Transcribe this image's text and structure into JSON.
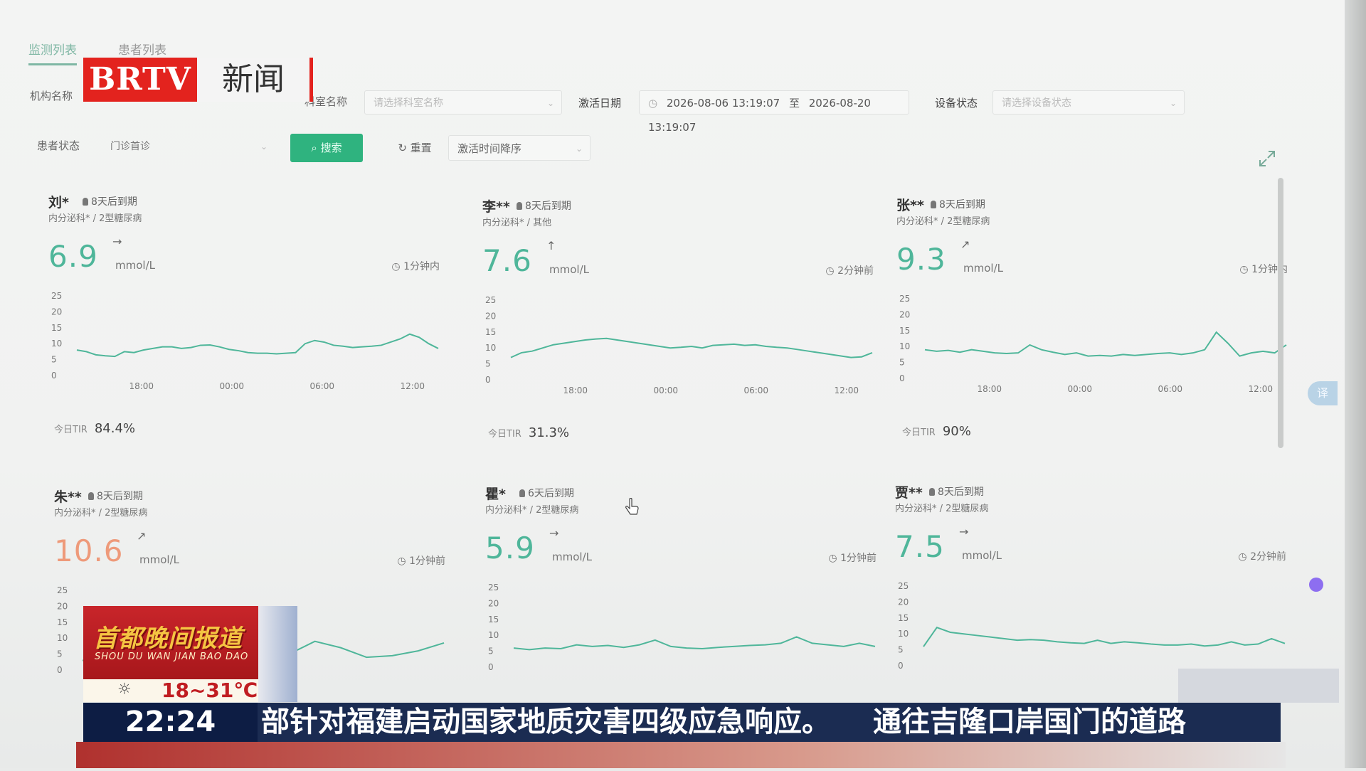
{
  "tabs": [
    "监测列表",
    "患者列表"
  ],
  "filters": {
    "org_label": "机构名称",
    "dept_label": "科室名称",
    "dept_placeholder": "请选择科室名称",
    "activation_label": "激活日期",
    "date_start": "2026-08-06 13:19:07",
    "date_sep": "至",
    "date_end": "2026-08-20 13:19:07",
    "device_label": "设备状态",
    "device_placeholder": "请选择设备状态",
    "patient_status_label": "患者状态",
    "patient_status_value": "门诊首诊",
    "search_label": "搜索",
    "reset_label": "重置",
    "sort_value": "激活时间降序"
  },
  "chart_axes": {
    "y_ticks": [
      "25",
      "20",
      "15",
      "10",
      "5",
      "0"
    ],
    "x_ticks": [
      "18:00",
      "00:00",
      "06:00",
      "12:00"
    ]
  },
  "patients": [
    {
      "name": "刘*",
      "expiry": "8天后到期",
      "dept": "内分泌科* / 2型糖尿病",
      "glucose": "6.9",
      "arrow": "→",
      "unit": "mmol/L",
      "updated": "1分钟内",
      "tir_label": "今日TIR",
      "tir": "84.4%",
      "series": [
        8,
        7.5,
        6.5,
        6.2,
        6,
        7.5,
        7.2,
        8,
        8.5,
        9,
        9,
        8.5,
        8.8,
        9.5,
        9.6,
        9,
        8.2,
        7.8,
        7.2,
        7,
        7,
        6.8,
        7,
        7.2,
        10,
        11,
        10.5,
        9.5,
        9.2,
        8.8,
        9,
        9.2,
        9.5,
        10.5,
        11.5,
        13,
        12,
        10,
        8.5
      ]
    },
    {
      "name": "李**",
      "expiry": "8天后到期",
      "dept": "内分泌科* / 其他",
      "glucose": "7.6",
      "arrow": "↑",
      "unit": "mmol/L",
      "updated": "2分钟前",
      "tir_label": "今日TIR",
      "tir": "31.3%",
      "series": [
        7,
        8.5,
        9,
        10,
        11,
        11.5,
        12,
        12.5,
        12.8,
        13,
        12.5,
        12,
        11.5,
        11,
        10.5,
        10,
        10.2,
        10.5,
        10,
        10.8,
        11,
        11.2,
        10.8,
        11,
        10.5,
        10.2,
        10,
        9.5,
        9,
        8.5,
        8,
        7.5,
        7,
        7.2,
        8.5
      ]
    },
    {
      "name": "张**",
      "expiry": "8天后到期",
      "dept": "内分泌科* / 2型糖尿病",
      "glucose": "9.3",
      "arrow": "↗",
      "unit": "mmol/L",
      "updated": "1分钟内",
      "tir_label": "今日TIR",
      "tir": "90%",
      "series": [
        9,
        8.5,
        8.8,
        8.2,
        9,
        8.5,
        8,
        7.8,
        8,
        10.5,
        9,
        8.2,
        7.5,
        8,
        7,
        7.2,
        7,
        7.5,
        7.2,
        7.5,
        7.8,
        8,
        7.5,
        8,
        9,
        14.5,
        11,
        7,
        8,
        8.5,
        8,
        10.5
      ]
    },
    {
      "name": "朱**",
      "expiry": "8天后到期",
      "dept": "内分泌科* / 2型糖尿病",
      "glucose": "10.6",
      "arrow": "↗",
      "unit": "mmol/L",
      "updated": "1分钟前",
      "series": [
        3,
        3.2,
        3.5,
        3,
        3.4,
        3.8,
        3.5,
        4,
        5,
        9,
        7,
        4,
        4.5,
        6,
        8.5
      ]
    },
    {
      "name": "瞿*",
      "expiry": "6天后到期",
      "dept": "内分泌科* / 2型糖尿病",
      "glucose": "5.9",
      "arrow": "→",
      "unit": "mmol/L",
      "updated": "1分钟前",
      "series": [
        6,
        5.5,
        6,
        5.8,
        7,
        6.5,
        6.8,
        6.2,
        7,
        8.5,
        6.5,
        6,
        5.8,
        6.2,
        6.5,
        6.8,
        7,
        7.5,
        9.5,
        7.5,
        7,
        6.5,
        7.5,
        6.5
      ]
    },
    {
      "name": "贾**",
      "expiry": "8天后到期",
      "dept": "内分泌科* / 2型糖尿病",
      "glucose": "7.5",
      "arrow": "→",
      "unit": "mmol/L",
      "updated": "2分钟前",
      "series": [
        6,
        12,
        10.5,
        10,
        9.5,
        9,
        8.5,
        8,
        8.2,
        8,
        7.5,
        7.2,
        7,
        8,
        7,
        7.5,
        7.2,
        6.8,
        6.5,
        6.5,
        6.8,
        6.2,
        6.5,
        7.5,
        6.5,
        6.8,
        8.5,
        7
      ]
    }
  ],
  "overlay": {
    "logo_left": "BRTV",
    "logo_right": "新闻",
    "program": "首都晚间报道",
    "program_pinyin": "SHOU DU WAN JIAN BAO DAO",
    "weather_icon": "sun-icon",
    "temperature": "18~31℃",
    "time": "22:24",
    "ticker": "部针对福建启动国家地质灾害四级应急响应。　　通往吉隆口岸国门的道路"
  },
  "side_button": "译",
  "colors": {
    "accent": "#2fb37f",
    "line": "#4fb69a",
    "high": "#ee9a7a",
    "brtv_red": "#e3231e"
  }
}
